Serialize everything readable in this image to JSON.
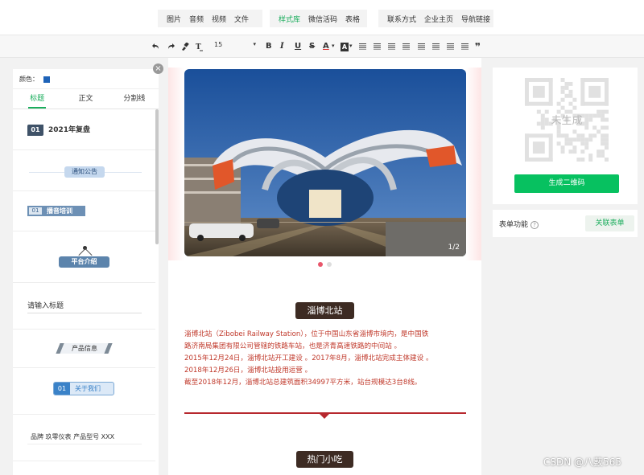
{
  "top_menu": {
    "group1": [
      "图片",
      "音频",
      "视频",
      "文件"
    ],
    "group2": [
      "样式库",
      "微信活码",
      "表格"
    ],
    "group3": [
      "联系方式",
      "企业主页",
      "导航链接"
    ],
    "active": "样式库"
  },
  "toolbar": {
    "font_size": "15",
    "bold": "B",
    "italic": "I",
    "underline": "U",
    "strike": "S",
    "font_color": "A",
    "bg_color": "A",
    "quote": "❞"
  },
  "left_panel": {
    "color_label": "颜色：",
    "color_value": "#1e63b8",
    "tabs": [
      "标题",
      "正文",
      "分割线"
    ],
    "templates": {
      "t1_num": "01",
      "t1_text": "2021年复盘",
      "t2_text": "通知公告",
      "t3_num": "01",
      "t3_text": "播音培训",
      "t4_text": "平台介绍",
      "t5_text": "请输入标题",
      "t6_text": "产品信息",
      "t7_num": "01",
      "t7_text": "关于我们",
      "t8_text": "品牌  玖零仪表     产品型号  XXX"
    }
  },
  "editor": {
    "slide_counter": "1/2",
    "section1_title": "淄博北站",
    "paragraphs": [
      "淄博北站（Zibobei Railway Station），位于中国山东省淄博市境内，是中国铁",
      "路济南局集团有限公司管辖的铁路车站，也是济青高速铁路的中间站 。",
      "2015年12月24日，淄博北站开工建设 。2017年8月，淄博北站完成主体建设 。",
      "2018年12月26日，淄博北站投用运营 。",
      "截至2018年12月，淄博北站总建筑面积34997平方米，站台规模达3台8线。"
    ],
    "section2_title": "热门小吃",
    "text_color": "#c0392b",
    "accent_color": "#b7282e"
  },
  "right_panel": {
    "qr_status": "未生成",
    "generate_button": "生成二维码",
    "form_label": "表单功能",
    "help_icon": "?",
    "link_button": "关联表单"
  },
  "watermark": "CSDN @八薮565"
}
